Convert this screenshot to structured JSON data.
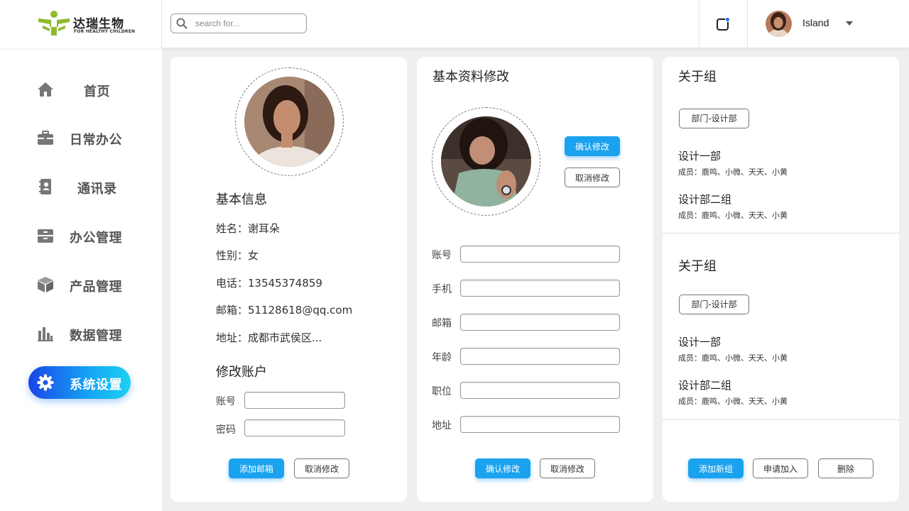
{
  "brand": {
    "name": "达瑞生物",
    "tagline": "FOR HEALTHY CHILDREN",
    "colors": {
      "logo_green": "#8fba2c",
      "accent_blue": "#1aa2ef",
      "active_gradient_start": "#1b45e8",
      "active_gradient_end": "#1dd2f2"
    }
  },
  "search": {
    "placeholder": "search for...",
    "icon": "search-icon"
  },
  "header": {
    "notification_icon": "notification-icon",
    "user": {
      "name": "Island",
      "caret_icon": "chevron-down-icon"
    }
  },
  "sidebar": {
    "items": [
      {
        "label": "首页",
        "icon": "home-icon",
        "active": false
      },
      {
        "label": "日常办公",
        "icon": "briefcase-icon",
        "active": false
      },
      {
        "label": "通讯录",
        "icon": "contacts-book-icon",
        "active": false
      },
      {
        "label": "办公管理",
        "icon": "cabinet-icon",
        "active": false
      },
      {
        "label": "产品管理",
        "icon": "cube-icon",
        "active": false
      },
      {
        "label": "数据管理",
        "icon": "bar-chart-icon",
        "active": false
      },
      {
        "label": "系统设置",
        "icon": "gear-icon",
        "active": true
      }
    ]
  },
  "profile_card": {
    "info_title": "基本信息",
    "info": [
      "姓名：谢耳朵",
      "性别：女",
      "电话：13545374859",
      "邮箱：51128618@qq.com",
      "地址：成都市武侯区..."
    ],
    "account_title": "修改账户",
    "account_fields": [
      {
        "label": "账号",
        "value": ""
      },
      {
        "label": "密码",
        "value": ""
      }
    ],
    "primary_button": "添加邮箱",
    "secondary_button": "取消修改"
  },
  "edit_card": {
    "title": "基本资料修改",
    "avatar_confirm": "确认修改",
    "avatar_cancel": "取消修改",
    "fields": [
      {
        "label": "账号",
        "value": ""
      },
      {
        "label": "手机",
        "value": ""
      },
      {
        "label": "邮箱",
        "value": ""
      },
      {
        "label": "年龄",
        "value": ""
      },
      {
        "label": "职位",
        "value": ""
      },
      {
        "label": "地址",
        "value": ""
      }
    ],
    "confirm_button": "确认修改",
    "cancel_button": "取消修改"
  },
  "group_card": {
    "sections": [
      {
        "title": "关于组",
        "tag": "部门-设计部",
        "groups": [
          {
            "name": "设计一部",
            "members": "成员：鹿鸣、小微、天天、小黄"
          },
          {
            "name": "设计部二组",
            "members": "成员：鹿鸣、小微、天天、小黄"
          }
        ]
      },
      {
        "title": "关于组",
        "tag": "部门-设计部",
        "groups": [
          {
            "name": "设计一部",
            "members": "成员：鹿鸣、小微、天天、小黄"
          },
          {
            "name": "设计部二组",
            "members": "成员：鹿鸣、小微、天天、小黄"
          }
        ]
      }
    ],
    "add_button": "添加新组",
    "join_button": "申请加入",
    "delete_button": "删除"
  }
}
